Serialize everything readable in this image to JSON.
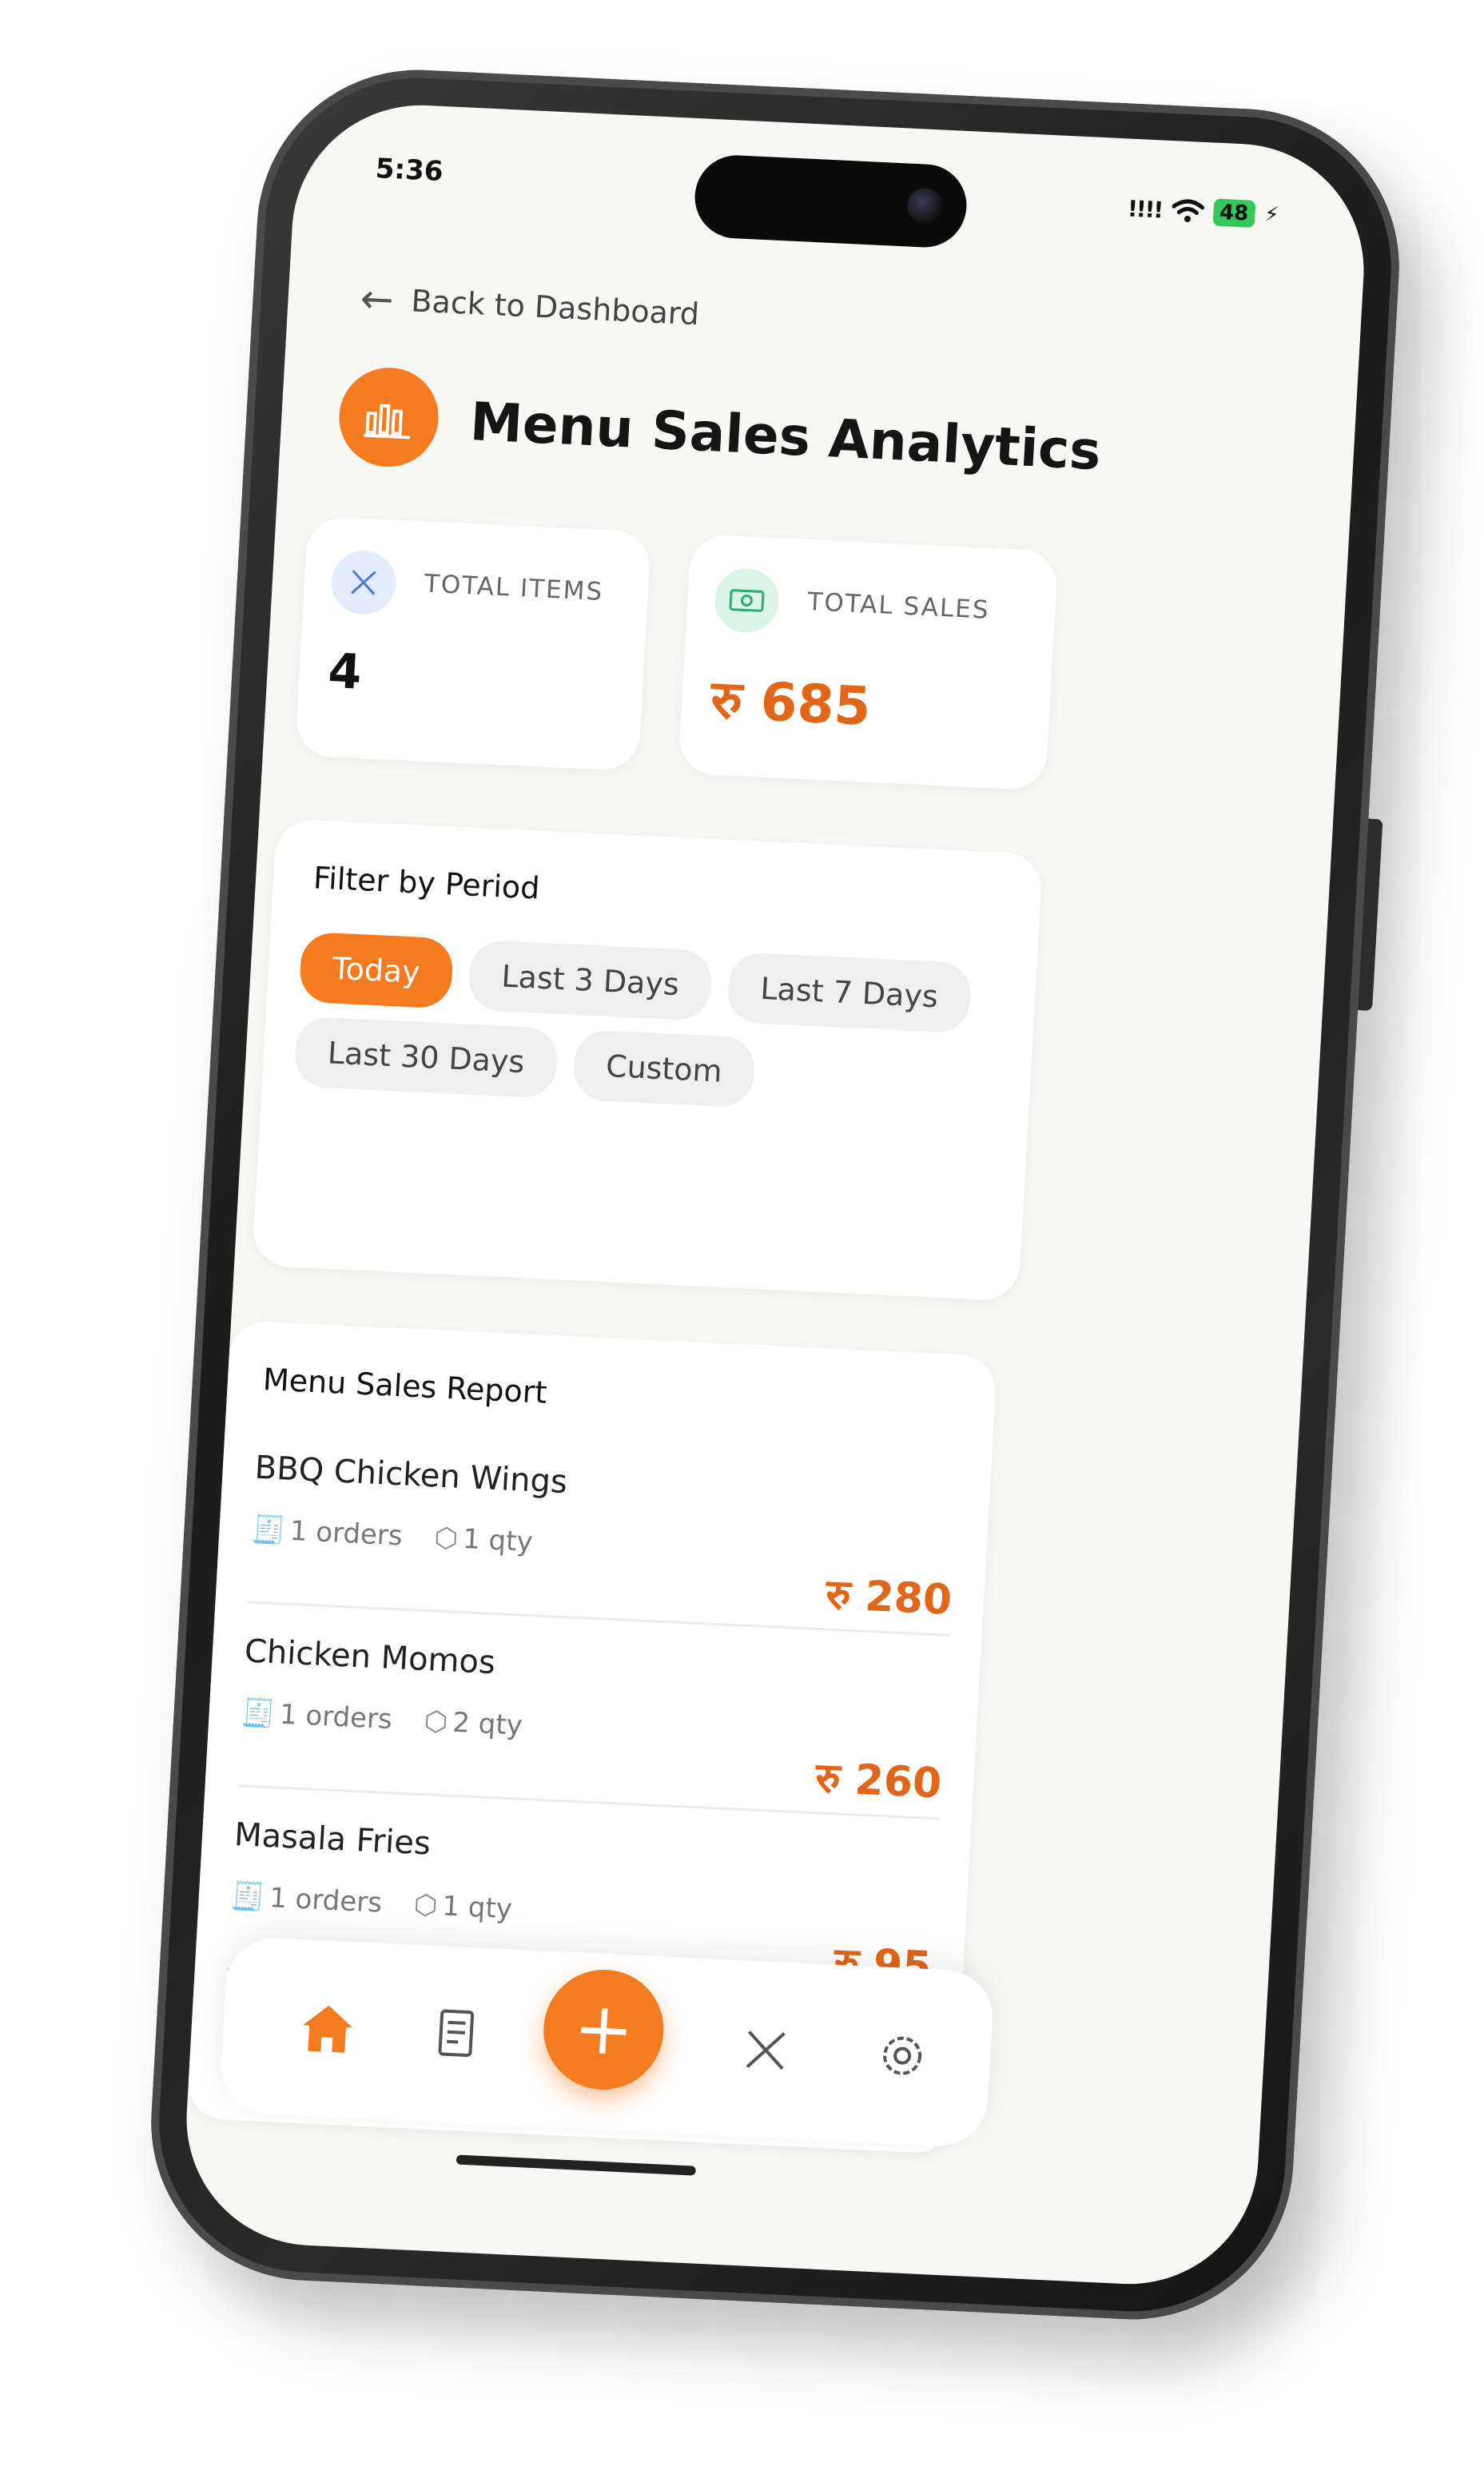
{
  "status_bar": {
    "time": "5:36",
    "signal": "!!!!",
    "battery": "48"
  },
  "back_label": "Back to Dashboard",
  "page_title": "Menu Sales Analytics",
  "stats": {
    "total_items": {
      "label": "TOTAL ITEMS",
      "value": "4"
    },
    "total_sales": {
      "label": "TOTAL SALES",
      "value": "रु 685"
    }
  },
  "filter": {
    "title": "Filter by Period",
    "chips": [
      "Today",
      "Last 3 Days",
      "Last 7 Days",
      "Last 30 Days",
      "Custom"
    ],
    "selected": "Today"
  },
  "report": {
    "title": "Menu Sales Report",
    "items": [
      {
        "name": "BBQ Chicken Wings",
        "orders": "1 orders",
        "qty": "1 qty",
        "amount": "रु 280"
      },
      {
        "name": "Chicken Momos",
        "orders": "1 orders",
        "qty": "2 qty",
        "amount": "रु 260"
      },
      {
        "name": "Masala Fries",
        "orders": "1 orders",
        "qty": "1 qty",
        "amount": "रु 95"
      }
    ]
  },
  "nav": {
    "fab": "+"
  },
  "colors": {
    "accent": "#f47b20",
    "amount": "#e2661a"
  }
}
